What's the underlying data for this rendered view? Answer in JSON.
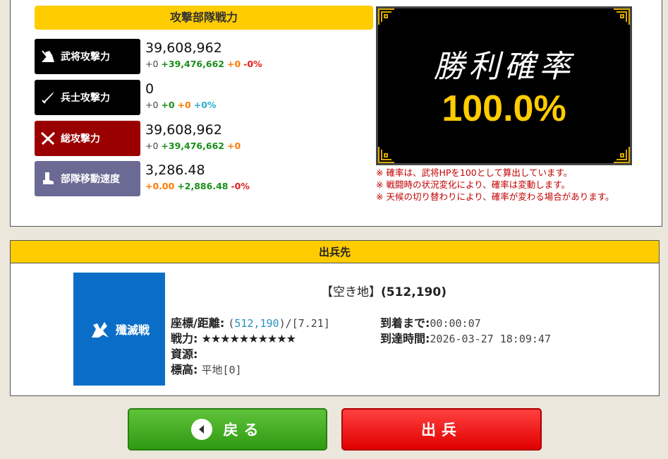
{
  "attack": {
    "title": "攻撃部隊戦力",
    "stats": [
      {
        "label": "武将攻撃力",
        "value": "39,608,962",
        "sub": [
          "+0",
          "+39,476,662",
          "+0",
          "-0%"
        ]
      },
      {
        "label": "兵士攻撃力",
        "value": "0",
        "sub": [
          "+0",
          "+0",
          "+0",
          "+0%"
        ]
      },
      {
        "label": "総攻撃力",
        "value": "39,608,962",
        "sub": [
          "+0",
          "+39,476,662",
          "+0",
          ""
        ]
      },
      {
        "label": "部隊移動速度",
        "value": "3,286.48",
        "sub": [
          "+0.00",
          "+2,886.48",
          "-0%",
          ""
        ]
      }
    ]
  },
  "win": {
    "title": "勝利確率",
    "value": "100.0%",
    "notes": [
      "※ 確率は、武将HPを100として算出しています。",
      "※ 戦闘時の状況変化により、確率は変動します。",
      "※ 天候の切り替わりにより、確率が変わる場合があります。"
    ]
  },
  "destination": {
    "header": "出兵先",
    "image_label": "殲滅戦",
    "name_bracket": "【空き地】",
    "name_coord": "(512,190)",
    "coord_label": "座標/距離:",
    "coord_link": "512,190",
    "coord_open": "(",
    "coord_rest": ")/[7.21]",
    "power_label": "戦力:",
    "power_stars": "★★★★★★★★★★",
    "resource_label": "資源:",
    "elevation_label": "標高:",
    "elevation_value": "平地[0]",
    "arrive_in_label": "到着まで:",
    "arrive_in_value": "00:00:07",
    "arrive_at_label": "到達時間:",
    "arrive_at_value": "2026-03-27 18:09:47"
  },
  "buttons": {
    "back": "戻る",
    "go": "出兵"
  },
  "colors": {
    "accent": "#ffcc00",
    "back_button": "#3aa81a",
    "go_button": "#ee1111"
  }
}
